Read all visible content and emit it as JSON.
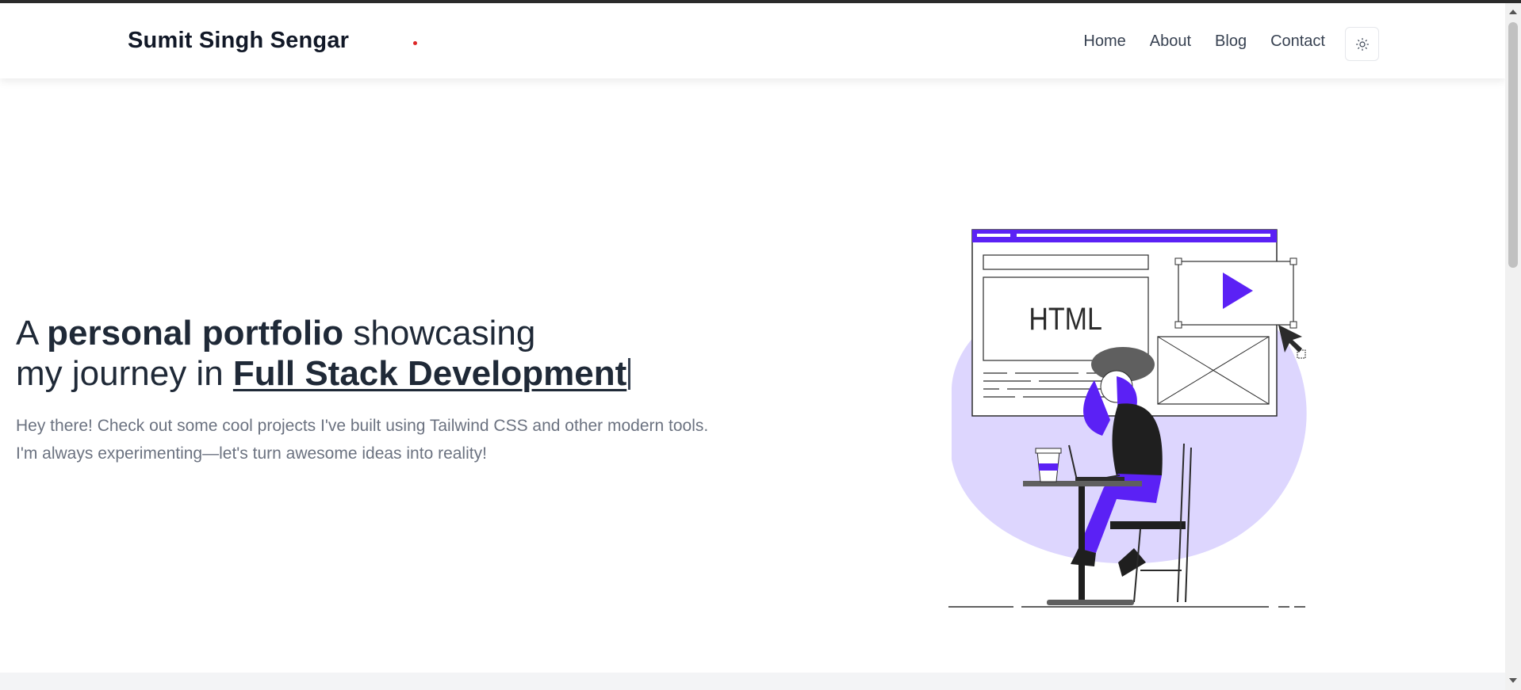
{
  "header": {
    "brand": "Sumit Singh Sengar",
    "nav": [
      {
        "label": "Home"
      },
      {
        "label": "About"
      },
      {
        "label": "Blog"
      },
      {
        "label": "Contact"
      }
    ],
    "theme_toggle_icon": "sun-icon"
  },
  "hero": {
    "title_prefix": "A ",
    "title_bold": "personal portfolio",
    "title_mid": " showcasing",
    "title_line2": "my journey in ",
    "title_highlight": "Full Stack Development",
    "desc_line1": "Hey there! Check out some cool projects I've built using Tailwind CSS and other modern tools.",
    "desc_line2": "I'm always experimenting—let's turn awesome ideas into reality!"
  },
  "illustration": {
    "html_label": "HTML",
    "icons": [
      "play-icon",
      "cursor-icon",
      "coffee-cup-icon",
      "laptop-icon"
    ]
  },
  "colors": {
    "accent": "#5b21f5",
    "blob": "#ddd6fe",
    "text": "#1f2937",
    "muted": "#6b7280"
  }
}
